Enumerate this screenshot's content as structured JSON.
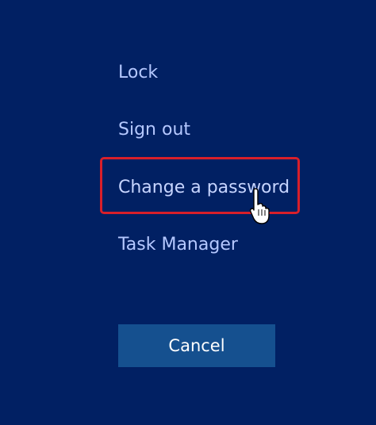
{
  "menu": {
    "items": [
      {
        "label": "Lock"
      },
      {
        "label": "Sign out"
      },
      {
        "label": "Change a password"
      },
      {
        "label": "Task Manager"
      }
    ]
  },
  "cancel": {
    "label": "Cancel"
  },
  "colors": {
    "background": "#012063",
    "item_text": "#b5c8ff",
    "button_bg": "#15508f",
    "highlight": "#d81f2a"
  },
  "icons": {
    "cursor": "hand-pointer-icon"
  }
}
